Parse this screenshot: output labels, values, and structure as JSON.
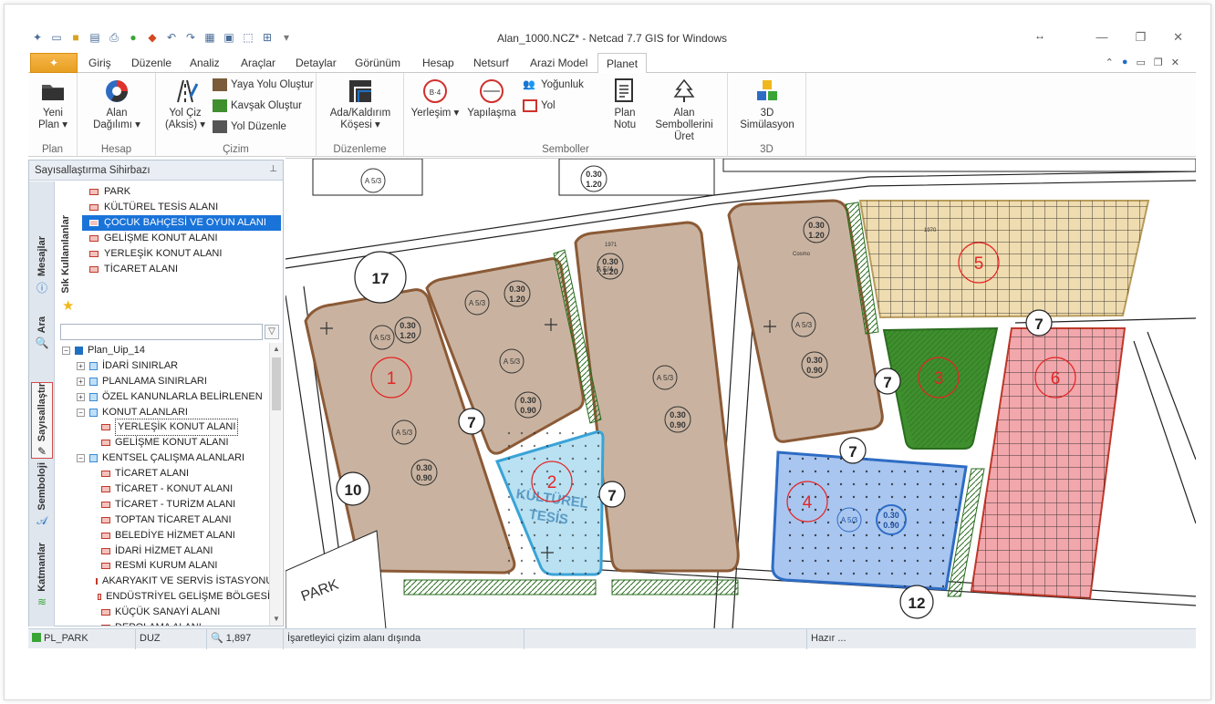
{
  "window": {
    "title": "Alan_1000.NCZ* - Netcad 7.7 GIS for Windows"
  },
  "tabs": [
    "Giriş",
    "Düzenle",
    "Analiz",
    "Araçlar",
    "Detaylar",
    "Görünüm",
    "Hesap",
    "Netsurf",
    "Arazi Model",
    "Planet"
  ],
  "active_tab": "Planet",
  "ribbon": {
    "plan": {
      "group": "Plan",
      "yeni_plan": "Yeni Plan ▾"
    },
    "hesap": {
      "group": "Hesap",
      "alan_dagilimi": "Alan Dağılımı ▾"
    },
    "cizim": {
      "group": "Çizim",
      "yol_ciz": "Yol Çiz (Aksis) ▾",
      "yaya_yolu": "Yaya Yolu Oluştur",
      "kavsak": "Kavşak Oluştur",
      "yol_duzenle": "Yol Düzenle"
    },
    "duzenleme": {
      "group": "Düzenleme",
      "ada_kaldirim": "Ada/Kaldırım Köşesi ▾"
    },
    "semboller": {
      "group": "Semboller",
      "yerlesim": "Yerleşim ▾",
      "yapilasma": "Yapılaşma",
      "yogunluk": "Yoğunluk",
      "yol": "Yol",
      "plan_notu": "Plan Notu",
      "alan_sembolleri": "Alan Sembollerini Üret"
    },
    "d3": {
      "group": "3D",
      "simulasyon": "3D Simülasyon"
    }
  },
  "left_panel": {
    "title": "Sayısallaştırma Sihirbazı",
    "vtabs": [
      "Mesajlar",
      "Ara",
      "Sayısallaştır",
      "Semboloji",
      "Katmanlar"
    ],
    "favorites_label": "Sık Kullanılanlar",
    "favorites": [
      "PARK",
      "KÜLTÜREL TESİS ALANI",
      "ÇOCUK BAHÇESİ VE OYUN ALANI",
      "GELİŞME KONUT ALANI",
      "YERLEŞİK KONUT ALANI",
      "TİCARET ALANI"
    ],
    "selected_favorite": 2,
    "filter_value": "",
    "tree": [
      {
        "label": "Plan_Uip_14",
        "level": 0,
        "exp": "−",
        "kind": "root"
      },
      {
        "label": "İDARİ SINIRLAR",
        "level": 1,
        "exp": "+",
        "kind": "folder"
      },
      {
        "label": "PLANLAMA SINIRLARI",
        "level": 1,
        "exp": "+",
        "kind": "folder"
      },
      {
        "label": "ÖZEL KANUNLARLA BELİRLENEN",
        "level": 1,
        "exp": "+",
        "kind": "folder"
      },
      {
        "label": "KONUT ALANLARI",
        "level": 1,
        "exp": "−",
        "kind": "folder"
      },
      {
        "label": "YERLEŞİK KONUT ALANI",
        "level": 2,
        "kind": "layer",
        "boxsel": true
      },
      {
        "label": "GELİŞME KONUT ALANI",
        "level": 2,
        "kind": "layer"
      },
      {
        "label": "KENTSEL ÇALIŞMA ALANLARI",
        "level": 1,
        "exp": "−",
        "kind": "folder"
      },
      {
        "label": "TİCARET ALANI",
        "level": 2,
        "kind": "layer"
      },
      {
        "label": "TİCARET - KONUT ALANI",
        "level": 2,
        "kind": "layer"
      },
      {
        "label": "TİCARET - TURİZM ALANI",
        "level": 2,
        "kind": "layer"
      },
      {
        "label": "TOPTAN TİCARET ALANI",
        "level": 2,
        "kind": "layer"
      },
      {
        "label": "BELEDİYE HİZMET ALANI",
        "level": 2,
        "kind": "layer"
      },
      {
        "label": "İDARİ HİZMET ALANI",
        "level": 2,
        "kind": "layer"
      },
      {
        "label": "RESMİ KURUM ALANI",
        "level": 2,
        "kind": "layer"
      },
      {
        "label": "AKARYAKIT VE SERVİS İSTASYONU",
        "level": 2,
        "kind": "layer"
      },
      {
        "label": "ENDÜSTRİYEL GELİŞME BÖLGESİ",
        "level": 2,
        "kind": "layer"
      },
      {
        "label": "KÜÇÜK SANAYİ ALANI",
        "level": 2,
        "kind": "layer"
      },
      {
        "label": "DEPOLAMA ALANI",
        "level": 2,
        "kind": "layer"
      }
    ]
  },
  "map": {
    "parcel_labels": [
      "1",
      "2",
      "3",
      "4",
      "5",
      "6"
    ],
    "road_labels": [
      "17",
      "7",
      "10",
      "12",
      "7",
      "7",
      "7",
      "7",
      "12"
    ],
    "text_labels": [
      "KÜLTÜREL",
      "TESİS",
      "PARK",
      "Cosmo",
      "1971",
      "1970"
    ],
    "taks_kaks": [
      "0.30",
      "1.20",
      "0.30",
      "0.90"
    ],
    "a_markers": [
      "A 5/3",
      "A 5/4"
    ],
    "colors": {
      "residential": "#c9b3a0",
      "residential_border": "#8b5a36",
      "culture": "#b9e1f2",
      "park": "#3f8f2e",
      "blue_area": "#a8c6f0",
      "yellow_area": "#efdcb0",
      "red_area": "#f1a7ab",
      "label_red": "#e32626"
    }
  },
  "status_bar": {
    "layer": "PL_PARK",
    "mode": "DUZ",
    "scale": "1,897",
    "message": "İşaretleyici çizim alanı dışında",
    "state": "Hazır ..."
  }
}
